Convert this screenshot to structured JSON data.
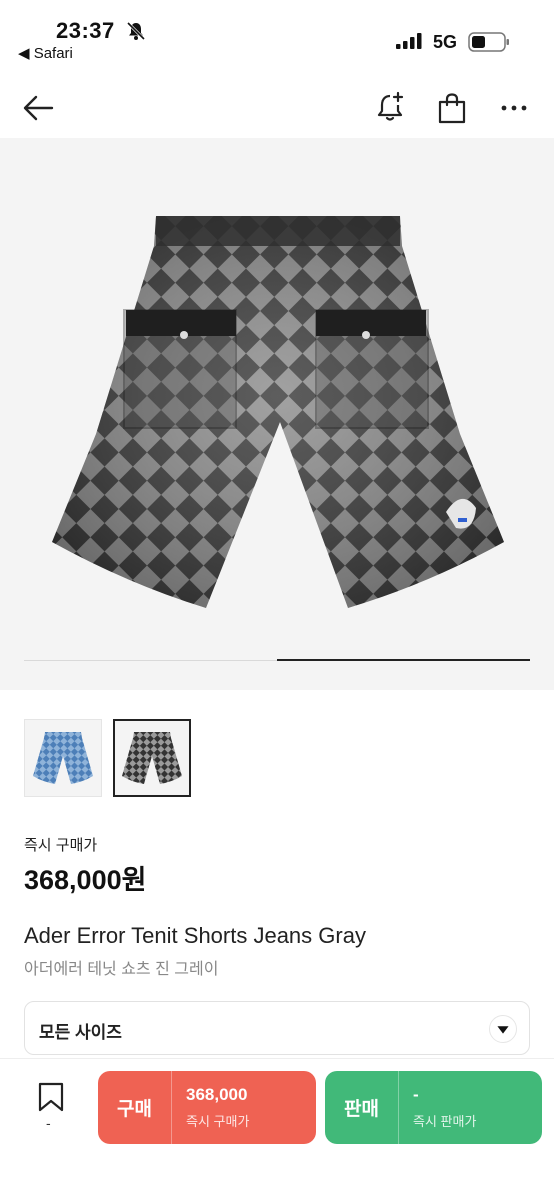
{
  "status_bar": {
    "time": "23:37",
    "back_app": "◀ Safari",
    "network": "5G",
    "icons": [
      "bell-off-icon",
      "signal-icon",
      "battery-icon"
    ]
  },
  "nav": {
    "icons": [
      "back-arrow-icon",
      "alert-add-icon",
      "shopping-bag-icon",
      "more-icon"
    ]
  },
  "gallery": {
    "page": 2,
    "total": 2,
    "thumbnails": [
      {
        "name": "blue-denim-shorts",
        "selected": false
      },
      {
        "name": "gray-check-shorts",
        "selected": true
      }
    ]
  },
  "product": {
    "instant_buy_label": "즉시 구매가",
    "price": "368,000원",
    "name_en": "Ader Error Tenit Shorts Jeans Gray",
    "name_ko": "아더에러 테닛 쇼츠 진 그레이"
  },
  "size_select": {
    "label": "모든 사이즈"
  },
  "bottom_bar": {
    "bookmark_count": "-",
    "buy": {
      "label": "구매",
      "value": "368,000",
      "sub": "즉시 구매가"
    },
    "sell": {
      "label": "판매",
      "value": "-",
      "sub": "즉시 판매가"
    }
  },
  "colors": {
    "buy": "#ef6253",
    "sell": "#41b979",
    "text": "#222222",
    "muted": "#888888"
  }
}
